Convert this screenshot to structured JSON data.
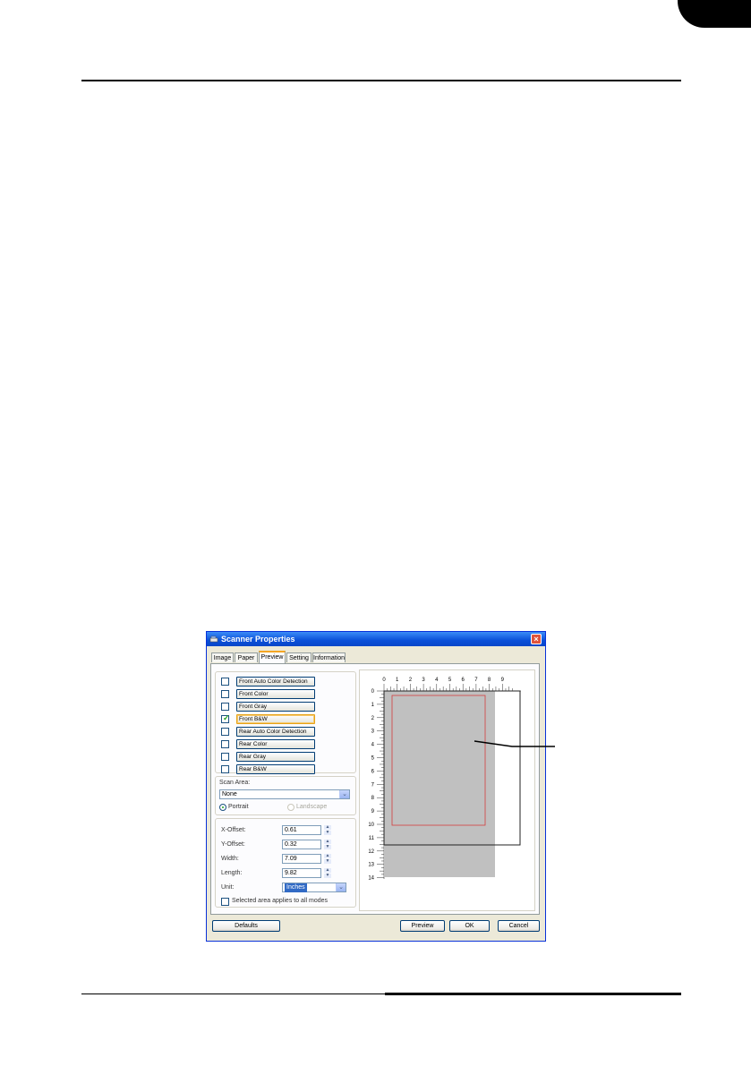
{
  "window": {
    "title": "Scanner Properties",
    "close_glyph": "×"
  },
  "tabs": [
    {
      "label": "Image"
    },
    {
      "label": "Paper"
    },
    {
      "label": "Preview"
    },
    {
      "label": "Setting"
    },
    {
      "label": "Information"
    }
  ],
  "modes": [
    {
      "label": "Front Auto Color Detection",
      "checked": false
    },
    {
      "label": "Front Color",
      "checked": false
    },
    {
      "label": "Front Gray",
      "checked": false
    },
    {
      "label": "Front B&W",
      "checked": true
    },
    {
      "label": "Rear Auto Color Detection",
      "checked": false
    },
    {
      "label": "Rear Color",
      "checked": false
    },
    {
      "label": "Rear Gray",
      "checked": false
    },
    {
      "label": "Rear B&W",
      "checked": false
    }
  ],
  "scan_area": {
    "label": "Scan Area:",
    "value": "None",
    "portrait": "Portrait",
    "landscape": "Landscape",
    "selected": "Portrait"
  },
  "dimensions": {
    "x_offset_label": "X-Offset:",
    "x_offset": "0.61",
    "y_offset_label": "Y-Offset:",
    "y_offset": "0.32",
    "width_label": "Width:",
    "width": "7.09",
    "length_label": "Length:",
    "length": "9.82",
    "unit_label": "Unit:",
    "unit": "Inches",
    "applies_all_label": "Selected area applies to all modes"
  },
  "preview": {
    "h_ticks": [
      "0",
      "1",
      "2",
      "3",
      "4",
      "5",
      "6",
      "7",
      "8",
      "9"
    ],
    "v_ticks": [
      "0",
      "1",
      "2",
      "3",
      "4",
      "5",
      "6",
      "7",
      "8",
      "9",
      "10",
      "11",
      "12",
      "13",
      "14"
    ]
  },
  "buttons": {
    "defaults": "Defaults",
    "preview": "Preview",
    "ok": "OK",
    "cancel": "Cancel"
  },
  "colors": {
    "titlebar": "#0a4fd8",
    "selection_frame": "#d23c3c",
    "paper_area": "#c0c0c0",
    "unit_highlight": "#316ac5"
  }
}
